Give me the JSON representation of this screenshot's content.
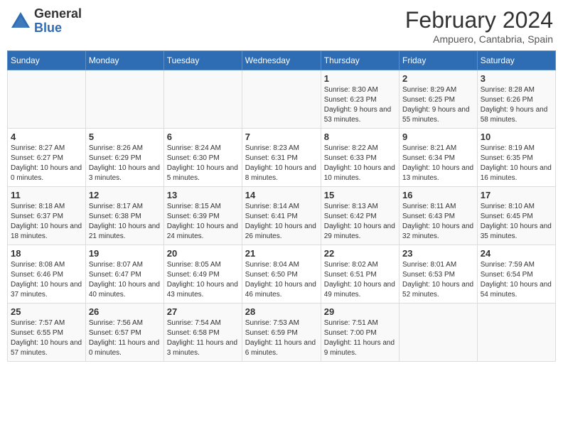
{
  "logo": {
    "general": "General",
    "blue": "Blue"
  },
  "title": {
    "month_year": "February 2024",
    "location": "Ampuero, Cantabria, Spain"
  },
  "days_of_week": [
    "Sunday",
    "Monday",
    "Tuesday",
    "Wednesday",
    "Thursday",
    "Friday",
    "Saturday"
  ],
  "weeks": [
    [
      {
        "day": "",
        "info": ""
      },
      {
        "day": "",
        "info": ""
      },
      {
        "day": "",
        "info": ""
      },
      {
        "day": "",
        "info": ""
      },
      {
        "day": "1",
        "info": "Sunrise: 8:30 AM\nSunset: 6:23 PM\nDaylight: 9 hours\nand 53 minutes."
      },
      {
        "day": "2",
        "info": "Sunrise: 8:29 AM\nSunset: 6:25 PM\nDaylight: 9 hours\nand 55 minutes."
      },
      {
        "day": "3",
        "info": "Sunrise: 8:28 AM\nSunset: 6:26 PM\nDaylight: 9 hours\nand 58 minutes."
      }
    ],
    [
      {
        "day": "4",
        "info": "Sunrise: 8:27 AM\nSunset: 6:27 PM\nDaylight: 10 hours\nand 0 minutes."
      },
      {
        "day": "5",
        "info": "Sunrise: 8:26 AM\nSunset: 6:29 PM\nDaylight: 10 hours\nand 3 minutes."
      },
      {
        "day": "6",
        "info": "Sunrise: 8:24 AM\nSunset: 6:30 PM\nDaylight: 10 hours\nand 5 minutes."
      },
      {
        "day": "7",
        "info": "Sunrise: 8:23 AM\nSunset: 6:31 PM\nDaylight: 10 hours\nand 8 minutes."
      },
      {
        "day": "8",
        "info": "Sunrise: 8:22 AM\nSunset: 6:33 PM\nDaylight: 10 hours\nand 10 minutes."
      },
      {
        "day": "9",
        "info": "Sunrise: 8:21 AM\nSunset: 6:34 PM\nDaylight: 10 hours\nand 13 minutes."
      },
      {
        "day": "10",
        "info": "Sunrise: 8:19 AM\nSunset: 6:35 PM\nDaylight: 10 hours\nand 16 minutes."
      }
    ],
    [
      {
        "day": "11",
        "info": "Sunrise: 8:18 AM\nSunset: 6:37 PM\nDaylight: 10 hours\nand 18 minutes."
      },
      {
        "day": "12",
        "info": "Sunrise: 8:17 AM\nSunset: 6:38 PM\nDaylight: 10 hours\nand 21 minutes."
      },
      {
        "day": "13",
        "info": "Sunrise: 8:15 AM\nSunset: 6:39 PM\nDaylight: 10 hours\nand 24 minutes."
      },
      {
        "day": "14",
        "info": "Sunrise: 8:14 AM\nSunset: 6:41 PM\nDaylight: 10 hours\nand 26 minutes."
      },
      {
        "day": "15",
        "info": "Sunrise: 8:13 AM\nSunset: 6:42 PM\nDaylight: 10 hours\nand 29 minutes."
      },
      {
        "day": "16",
        "info": "Sunrise: 8:11 AM\nSunset: 6:43 PM\nDaylight: 10 hours\nand 32 minutes."
      },
      {
        "day": "17",
        "info": "Sunrise: 8:10 AM\nSunset: 6:45 PM\nDaylight: 10 hours\nand 35 minutes."
      }
    ],
    [
      {
        "day": "18",
        "info": "Sunrise: 8:08 AM\nSunset: 6:46 PM\nDaylight: 10 hours\nand 37 minutes."
      },
      {
        "day": "19",
        "info": "Sunrise: 8:07 AM\nSunset: 6:47 PM\nDaylight: 10 hours\nand 40 minutes."
      },
      {
        "day": "20",
        "info": "Sunrise: 8:05 AM\nSunset: 6:49 PM\nDaylight: 10 hours\nand 43 minutes."
      },
      {
        "day": "21",
        "info": "Sunrise: 8:04 AM\nSunset: 6:50 PM\nDaylight: 10 hours\nand 46 minutes."
      },
      {
        "day": "22",
        "info": "Sunrise: 8:02 AM\nSunset: 6:51 PM\nDaylight: 10 hours\nand 49 minutes."
      },
      {
        "day": "23",
        "info": "Sunrise: 8:01 AM\nSunset: 6:53 PM\nDaylight: 10 hours\nand 52 minutes."
      },
      {
        "day": "24",
        "info": "Sunrise: 7:59 AM\nSunset: 6:54 PM\nDaylight: 10 hours\nand 54 minutes."
      }
    ],
    [
      {
        "day": "25",
        "info": "Sunrise: 7:57 AM\nSunset: 6:55 PM\nDaylight: 10 hours\nand 57 minutes."
      },
      {
        "day": "26",
        "info": "Sunrise: 7:56 AM\nSunset: 6:57 PM\nDaylight: 11 hours\nand 0 minutes."
      },
      {
        "day": "27",
        "info": "Sunrise: 7:54 AM\nSunset: 6:58 PM\nDaylight: 11 hours\nand 3 minutes."
      },
      {
        "day": "28",
        "info": "Sunrise: 7:53 AM\nSunset: 6:59 PM\nDaylight: 11 hours\nand 6 minutes."
      },
      {
        "day": "29",
        "info": "Sunrise: 7:51 AM\nSunset: 7:00 PM\nDaylight: 11 hours\nand 9 minutes."
      },
      {
        "day": "",
        "info": ""
      },
      {
        "day": "",
        "info": ""
      }
    ]
  ]
}
